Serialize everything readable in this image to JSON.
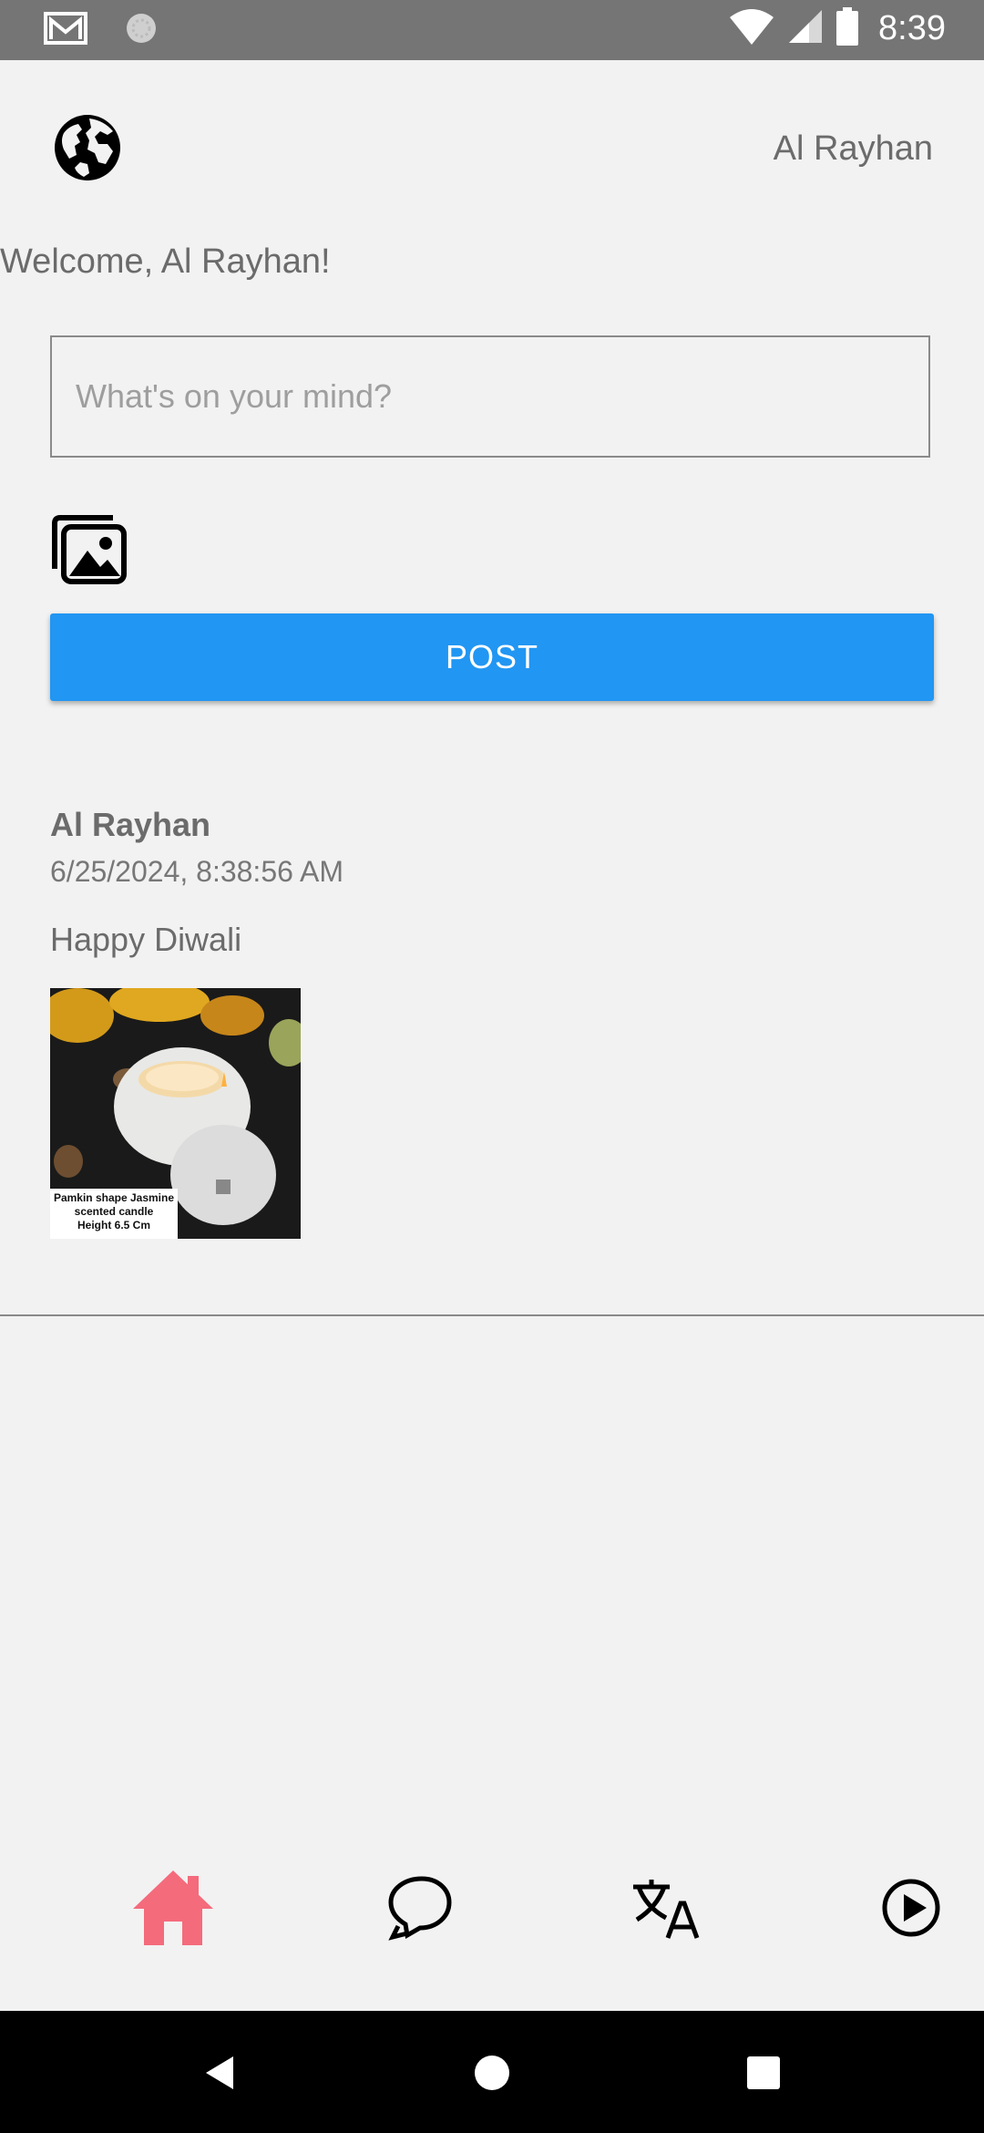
{
  "status_bar": {
    "time": "8:39",
    "icons": [
      "gmail-icon",
      "sync-icon",
      "wifi-icon",
      "signal-icon",
      "battery-icon"
    ]
  },
  "header": {
    "globe_icon": "globe-icon",
    "username": "Al Rayhan"
  },
  "welcome_text": "Welcome, Al Rayhan!",
  "composer": {
    "placeholder": "What's on your mind?",
    "value": "",
    "photo_icon": "photo-library-icon",
    "post_label": "POST"
  },
  "post": {
    "author": "Al Rayhan",
    "timestamp": "6/25/2024, 8:38:56 AM",
    "text": "Happy Diwali",
    "image_caption": [
      "Pamkin shape Jasmine",
      "scented candle",
      "Height 6.5 Cm"
    ]
  },
  "bottom_tabs": [
    {
      "icon": "home-icon",
      "active": true
    },
    {
      "icon": "chat-icon",
      "active": false
    },
    {
      "icon": "translate-icon",
      "active": false
    },
    {
      "icon": "play-circle-icon",
      "active": false
    }
  ],
  "colors": {
    "accent": "#2196f3",
    "active_tab": "#f46b7c",
    "background": "#f2f2f2",
    "status_bar": "#757575"
  }
}
